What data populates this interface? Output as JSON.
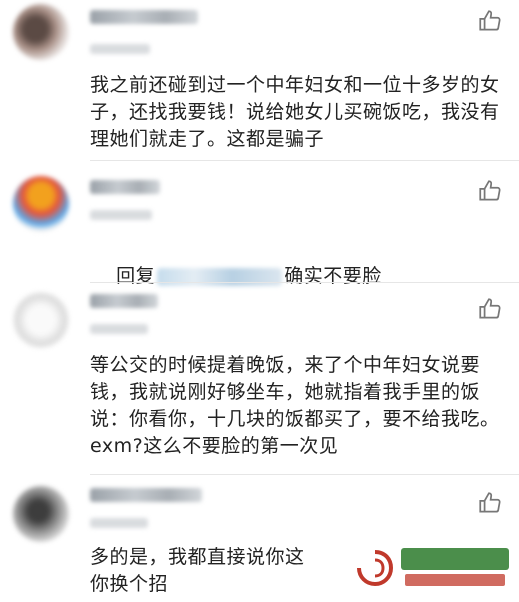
{
  "comments": [
    {
      "text": "我之前还碰到过一个中年妇女和一位十多岁的女子，还找我要钱！说给她女儿买碗饭吃，我没有理她们就走了。这都是骗子"
    },
    {
      "reply_prefix": "回复",
      "reply_suffix": "确实不要脸"
    },
    {
      "text": "等公交的时候提着晚饭，来了个中年妇女说要钱，我就说刚好够坐车，她就指着我手里的饭说：你看你，十几块的饭都买了，要不给我吃。exm?这么不要脸的第一次见"
    },
    {
      "text": "多的是，我都直接说你这    你换个招"
    }
  ],
  "icons": {
    "like": "thumbs-up-icon"
  },
  "colors": {
    "text": "#222222",
    "divider": "#e6e6e6",
    "watermark_green": "#2c7a2c",
    "watermark_red": "#c0392b"
  }
}
